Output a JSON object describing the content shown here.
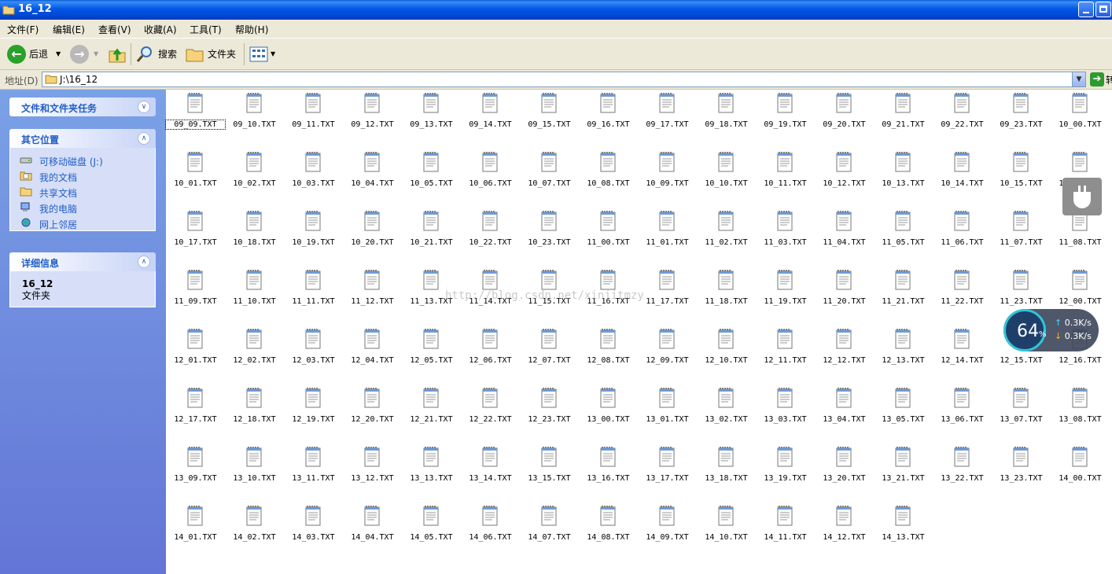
{
  "window": {
    "title": "16_12"
  },
  "menu": [
    "文件(F)",
    "编辑(E)",
    "查看(V)",
    "收藏(A)",
    "工具(T)",
    "帮助(H)"
  ],
  "toolbar": {
    "back_label": "后退",
    "search_label": "搜索",
    "folders_label": "文件夹"
  },
  "address": {
    "label": "地址(D)",
    "path": "J:\\16_12",
    "go_label": "转"
  },
  "sidebar": {
    "tasks_title": "文件和文件夹任务",
    "places_title": "其它位置",
    "places": [
      {
        "label": "可移动磁盘 (J:)",
        "icon": "removable-disk-icon"
      },
      {
        "label": "我的文档",
        "icon": "my-documents-icon"
      },
      {
        "label": "共享文档",
        "icon": "shared-documents-icon"
      },
      {
        "label": "我的电脑",
        "icon": "my-computer-icon"
      },
      {
        "label": "网上邻居",
        "icon": "network-icon"
      }
    ],
    "details_title": "详细信息",
    "details_name": "16_12",
    "details_type": "文件夹"
  },
  "files": [
    "09_09.TXT",
    "09_10.TXT",
    "09_11.TXT",
    "09_12.TXT",
    "09_13.TXT",
    "09_14.TXT",
    "09_15.TXT",
    "09_16.TXT",
    "09_17.TXT",
    "09_18.TXT",
    "09_19.TXT",
    "09_20.TXT",
    "09_21.TXT",
    "09_22.TXT",
    "09_23.TXT",
    "10_00.TXT",
    "10_01.TXT",
    "10_02.TXT",
    "10_03.TXT",
    "10_04.TXT",
    "10_05.TXT",
    "10_06.TXT",
    "10_07.TXT",
    "10_08.TXT",
    "10_09.TXT",
    "10_10.TXT",
    "10_11.TXT",
    "10_12.TXT",
    "10_13.TXT",
    "10_14.TXT",
    "10_15.TXT",
    "10_16.TXT",
    "10_17.TXT",
    "10_18.TXT",
    "10_19.TXT",
    "10_20.TXT",
    "10_21.TXT",
    "10_22.TXT",
    "10_23.TXT",
    "11_00.TXT",
    "11_01.TXT",
    "11_02.TXT",
    "11_03.TXT",
    "11_04.TXT",
    "11_05.TXT",
    "11_06.TXT",
    "11_07.TXT",
    "11_08.TXT",
    "11_09.TXT",
    "11_10.TXT",
    "11_11.TXT",
    "11_12.TXT",
    "11_13.TXT",
    "11_14.TXT",
    "11_15.TXT",
    "11_16.TXT",
    "11_17.TXT",
    "11_18.TXT",
    "11_19.TXT",
    "11_20.TXT",
    "11_21.TXT",
    "11_22.TXT",
    "11_23.TXT",
    "12_00.TXT",
    "12_01.TXT",
    "12_02.TXT",
    "12_03.TXT",
    "12_04.TXT",
    "12_05.TXT",
    "12_06.TXT",
    "12_07.TXT",
    "12_08.TXT",
    "12_09.TXT",
    "12_10.TXT",
    "12_11.TXT",
    "12_12.TXT",
    "12_13.TXT",
    "12_14.TXT",
    "12_15.TXT",
    "12_16.TXT",
    "12_17.TXT",
    "12_18.TXT",
    "12_19.TXT",
    "12_20.TXT",
    "12_21.TXT",
    "12_22.TXT",
    "12_23.TXT",
    "13_00.TXT",
    "13_01.TXT",
    "13_02.TXT",
    "13_03.TXT",
    "13_04.TXT",
    "13_05.TXT",
    "13_06.TXT",
    "13_07.TXT",
    "13_08.TXT",
    "13_09.TXT",
    "13_10.TXT",
    "13_11.TXT",
    "13_12.TXT",
    "13_13.TXT",
    "13_14.TXT",
    "13_15.TXT",
    "13_16.TXT",
    "13_17.TXT",
    "13_18.TXT",
    "13_19.TXT",
    "13_20.TXT",
    "13_21.TXT",
    "13_22.TXT",
    "13_23.TXT",
    "14_00.TXT",
    "14_01.TXT",
    "14_02.TXT",
    "14_03.TXT",
    "14_04.TXT",
    "14_05.TXT",
    "14_06.TXT",
    "14_07.TXT",
    "14_08.TXT",
    "14_09.TXT",
    "14_10.TXT",
    "14_11.TXT",
    "14_12.TXT",
    "14_13.TXT"
  ],
  "selected_file": "09_09.TXT",
  "watermark": "http://blog.csdn.net/xinjitmzy",
  "speed_widget": {
    "percent": "64",
    "percent_unit": "%",
    "upload": "0.3K/s",
    "download": "0.3K/s"
  },
  "colors": {
    "sidebar_top": "#7aa1e6",
    "sidebar_bottom": "#6375d6",
    "title_blue": "#0058e6",
    "link_blue": "#215dc6"
  }
}
